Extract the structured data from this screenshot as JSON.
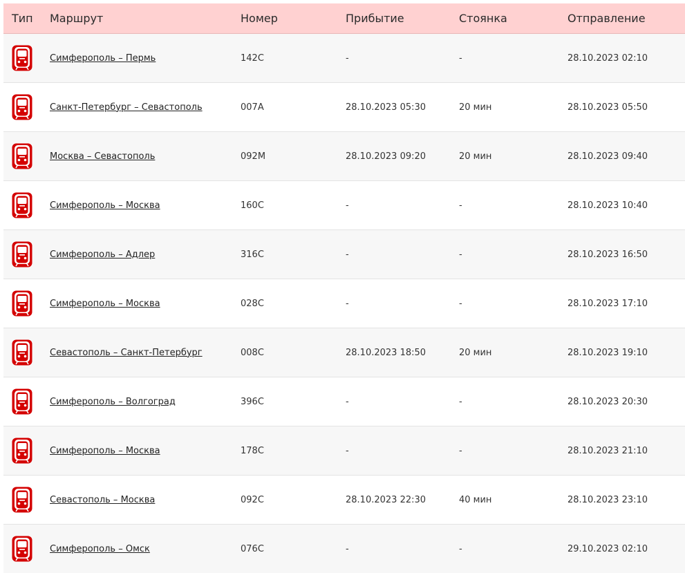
{
  "header": {
    "type": "Тип",
    "route": "Маршрут",
    "number": "Номер",
    "arrival": "Прибытие",
    "stop": "Стоянка",
    "departure": "Отправление"
  },
  "colors": {
    "header_bg": "#ffd1d1",
    "icon_red": "#d40000"
  },
  "rows": [
    {
      "icon": "train-icon",
      "route": "Симферополь – Пермь",
      "number": "142С",
      "arrival": "-",
      "stop": "-",
      "departure": "28.10.2023 02:10"
    },
    {
      "icon": "train-icon",
      "route": "Санкт-Петербург – Севастополь",
      "number": "007А",
      "arrival": "28.10.2023 05:30",
      "stop": "20 мин",
      "departure": "28.10.2023 05:50"
    },
    {
      "icon": "train-icon",
      "route": "Москва – Севастополь",
      "number": "092М",
      "arrival": "28.10.2023 09:20",
      "stop": "20 мин",
      "departure": "28.10.2023 09:40"
    },
    {
      "icon": "train-icon",
      "route": "Симферополь – Москва",
      "number": "160С",
      "arrival": "-",
      "stop": "-",
      "departure": "28.10.2023 10:40"
    },
    {
      "icon": "train-icon",
      "route": "Симферополь – Адлер",
      "number": "316С",
      "arrival": "-",
      "stop": "-",
      "departure": "28.10.2023 16:50"
    },
    {
      "icon": "train-icon",
      "route": "Симферополь – Москва",
      "number": "028С",
      "arrival": "-",
      "stop": "-",
      "departure": "28.10.2023 17:10"
    },
    {
      "icon": "train-icon",
      "route": "Севастополь – Санкт-Петербург",
      "number": "008С",
      "arrival": "28.10.2023 18:50",
      "stop": "20 мин",
      "departure": "28.10.2023 19:10"
    },
    {
      "icon": "train-icon",
      "route": "Симферополь – Волгоград",
      "number": "396С",
      "arrival": "-",
      "stop": "-",
      "departure": "28.10.2023 20:30"
    },
    {
      "icon": "train-icon",
      "route": "Симферополь – Москва",
      "number": "178С",
      "arrival": "-",
      "stop": "-",
      "departure": "28.10.2023 21:10"
    },
    {
      "icon": "train-icon",
      "route": "Севастополь – Москва",
      "number": "092С",
      "arrival": "28.10.2023 22:30",
      "stop": "40 мин",
      "departure": "28.10.2023 23:10"
    },
    {
      "icon": "train-icon",
      "route": "Симферополь – Омск",
      "number": "076С",
      "arrival": "-",
      "stop": "-",
      "departure": "29.10.2023 02:10"
    }
  ]
}
